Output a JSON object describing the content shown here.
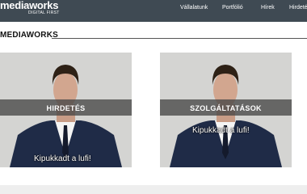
{
  "header": {
    "logo": "mediaworks",
    "tagline": "DIGITAL FIRST",
    "nav": [
      "Vállalatunk",
      "Portfólió",
      "Hírek",
      "Hirdetés"
    ]
  },
  "section": {
    "title": "MEDIAWORKS"
  },
  "cards": [
    {
      "label": "HIRDETÉS",
      "caption": "Kipukkadt a lufi!"
    },
    {
      "label": "SZOLGÁLTATÁSOK",
      "caption": "Kipukkadt a lufi!"
    }
  ],
  "colors": {
    "header_bg": "#3f4a53",
    "band_bg": "#464646"
  }
}
